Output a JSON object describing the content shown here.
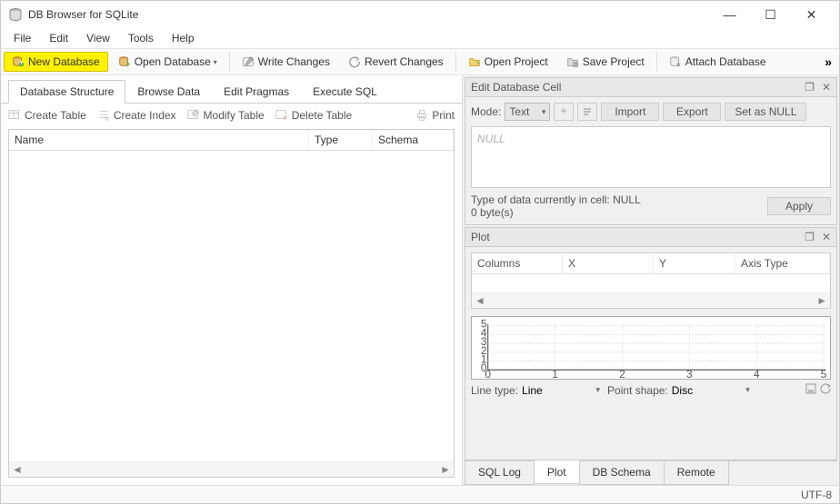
{
  "app": {
    "title": "DB Browser for SQLite"
  },
  "menu": [
    "File",
    "Edit",
    "View",
    "Tools",
    "Help"
  ],
  "toolbar": {
    "new_db": "New Database",
    "open_db": "Open Database",
    "write_changes": "Write Changes",
    "revert_changes": "Revert Changes",
    "open_project": "Open Project",
    "save_project": "Save Project",
    "attach_db": "Attach Database"
  },
  "left_tabs": [
    "Database Structure",
    "Browse Data",
    "Edit Pragmas",
    "Execute SQL"
  ],
  "left_tabs_active": 0,
  "struct_toolbar": {
    "create_table": "Create Table",
    "create_index": "Create Index",
    "modify_table": "Modify Table",
    "delete_table": "Delete Table",
    "print": "Print"
  },
  "struct_columns": [
    "Name",
    "Type",
    "Schema"
  ],
  "edit_cell_panel": {
    "title": "Edit Database Cell",
    "mode_label": "Mode:",
    "mode_value": "Text",
    "import": "Import",
    "export": "Export",
    "set_null": "Set as NULL",
    "null_placeholder": "NULL",
    "type_info": "Type of data currently in cell: NULL",
    "size_info": "0 byte(s)",
    "apply": "Apply"
  },
  "plot_panel": {
    "title": "Plot",
    "columns": [
      "Columns",
      "X",
      "Y",
      "Axis Type"
    ],
    "line_type_label": "Line type:",
    "line_type_value": "Line",
    "point_shape_label": "Point shape:",
    "point_shape_value": "Disc"
  },
  "chart_data": {
    "type": "line",
    "x": [
      0,
      1,
      2,
      3,
      4,
      5
    ],
    "series": [],
    "xlim": [
      0,
      5
    ],
    "ylim": [
      0,
      5
    ],
    "xticks": [
      0,
      1,
      2,
      3,
      4,
      5
    ],
    "yticks": [
      0,
      1,
      2,
      3,
      4,
      5
    ],
    "title": "",
    "xlabel": "",
    "ylabel": ""
  },
  "bottom_tabs": [
    "SQL Log",
    "Plot",
    "DB Schema",
    "Remote"
  ],
  "bottom_tabs_active": 1,
  "status": {
    "encoding": "UTF-8"
  }
}
